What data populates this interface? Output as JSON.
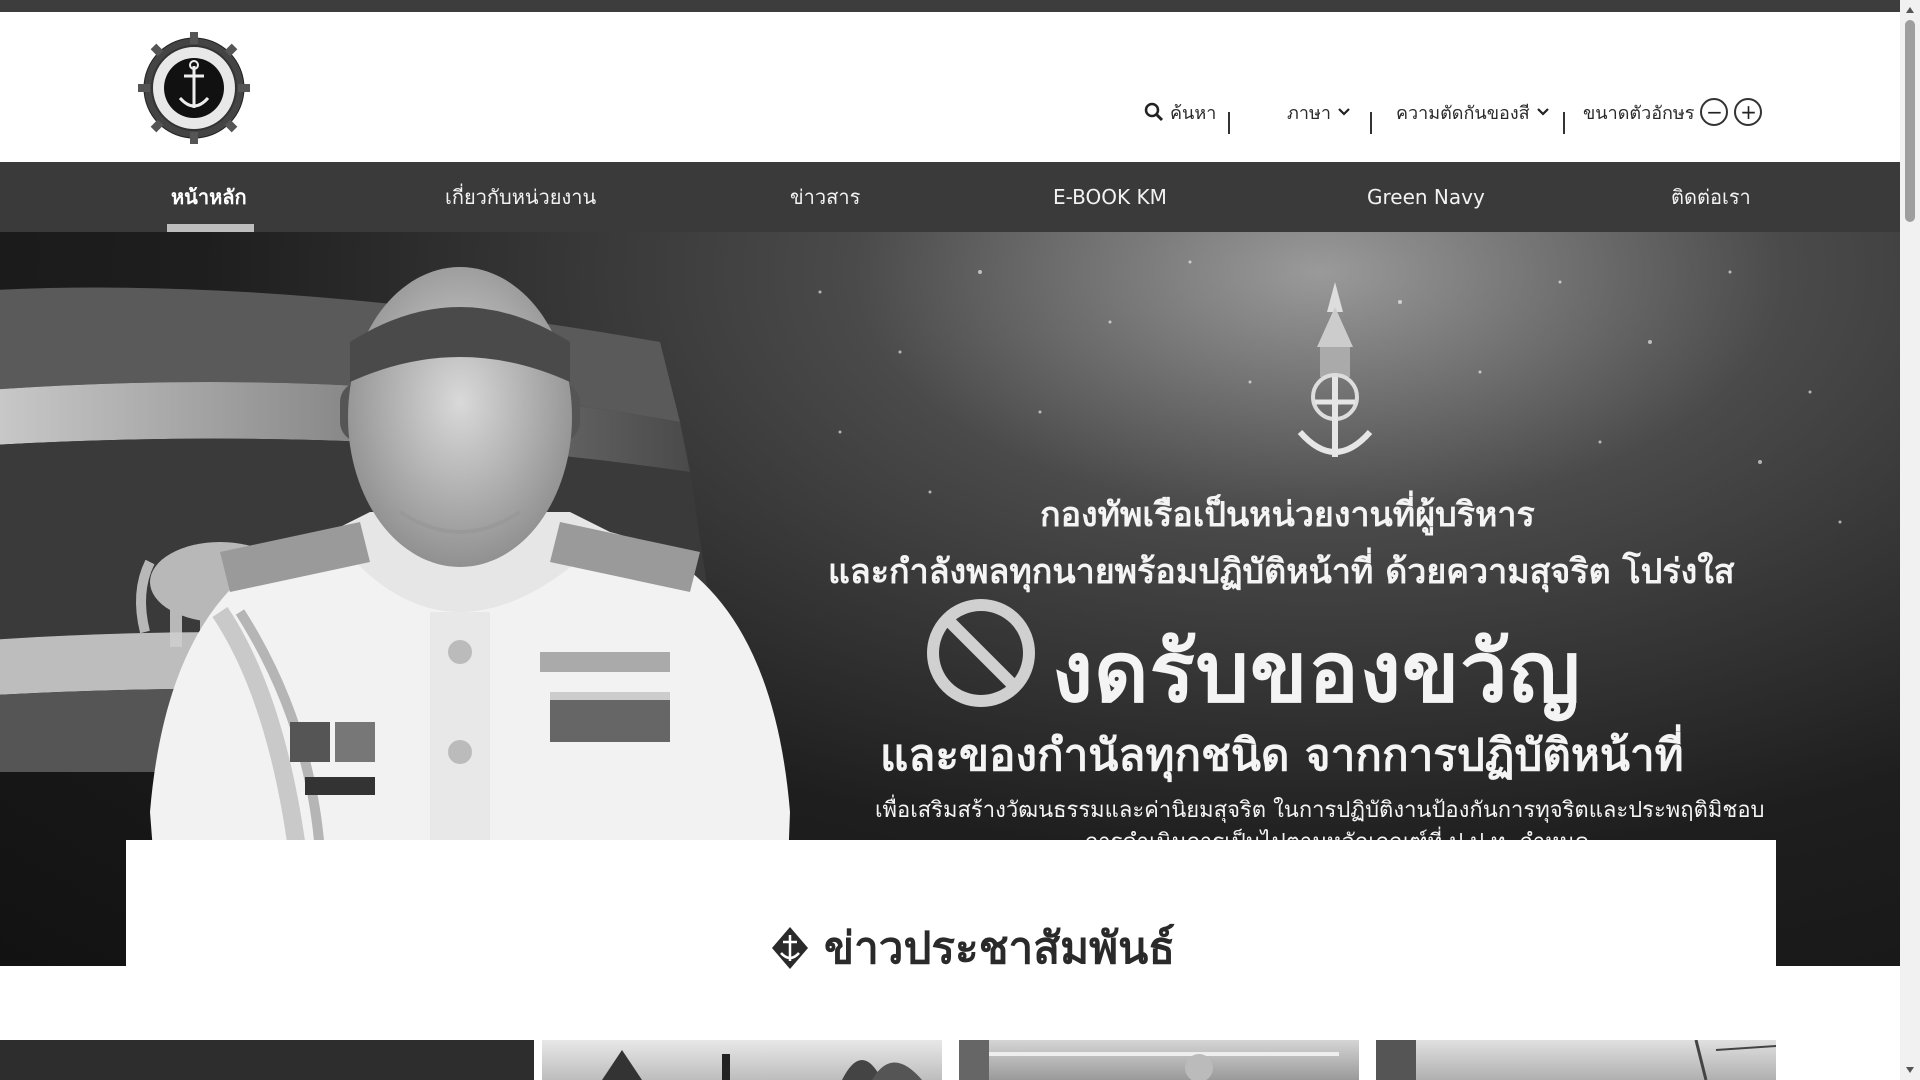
{
  "header": {
    "logo_label": "logo-emblem",
    "search_label": "ค้นหา",
    "language_label": "ภาษา",
    "contrast_label": "ความตัดกันของสี",
    "fontsize_label": "ขนาดตัวอักษร",
    "decrease_symbol": "−",
    "increase_symbol": "+"
  },
  "nav": {
    "items": [
      {
        "label": "หน้าหลัก",
        "active": true
      },
      {
        "label": "เกี่ยวกับหน่วยงาน"
      },
      {
        "label": "ข่าวสาร"
      },
      {
        "label": "E-BOOK KM"
      },
      {
        "label": "Green Navy"
      },
      {
        "label": "ติดต่อเรา"
      }
    ]
  },
  "hero": {
    "line1": "กองทัพเรือเป็นหน่วยงานที่ผู้บริหาร",
    "line2": "และกำลังพลทุกนายพร้อมปฏิบัติหน้าที่ ด้วยความสุจริต โปร่งใส",
    "line3": "งดรับของขวัญ",
    "line4": "และของกำนัลทุกชนิด จากการปฏิบัติหน้าที่",
    "line5": "เพื่อเสริมสร้างวัฒนธรรมและค่านิยมสุจริต ในการปฏิบัติงานป้องกันการทุจริตและประพฤติมิชอบ",
    "line6": "การดำเนินการเป็นไปตามหลักเกณฑ์ที่ ป.ป.ท. กำหนด"
  },
  "news": {
    "section_title": "ข่าวประชาสัมพันธ์"
  },
  "icons": {
    "search": "search-icon",
    "chevron": "chevron-down-icon",
    "diamond": "anchor-diamond-icon"
  },
  "colors": {
    "topbar": "#3d3d3d",
    "navbar": "#3a3a3a",
    "nav_text": "#f2f2f2",
    "underline": "#bdbdbd"
  }
}
